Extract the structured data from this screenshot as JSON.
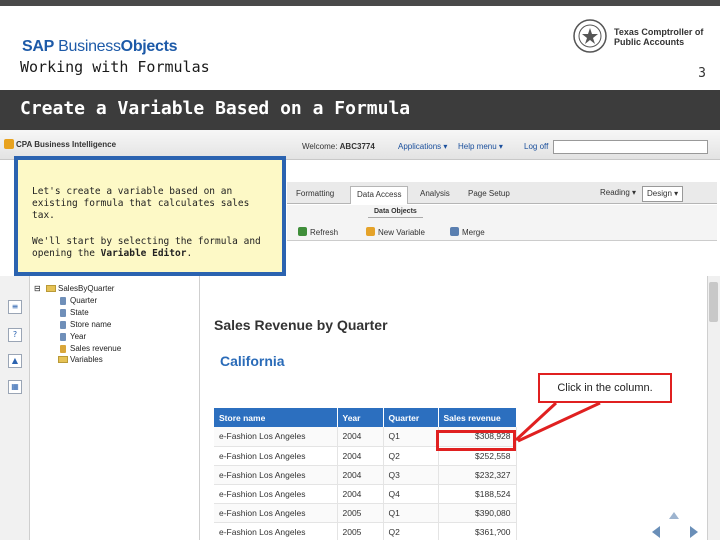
{
  "slide": {
    "logo_sap": "SAP",
    "logo_business": " Business",
    "logo_objects": "Objects",
    "subtitle": "Working with Formulas",
    "page_number": "3",
    "org_line1": "Texas Comptroller of",
    "org_line2": "Public Accounts",
    "section_title": "Create a Variable Based on a Formula"
  },
  "app": {
    "brand": "CPA Business Intelligence",
    "welcome_label": "Welcome:",
    "welcome_user": "ABC3774",
    "links": [
      "Applications ▾",
      "Help menu ▾",
      "Log off"
    ],
    "tabs": [
      "Formatting",
      "Data Access",
      "Analysis",
      "Page Setup"
    ],
    "active_tab": "Data Access",
    "modes": [
      "Reading ▾",
      "Design ▾"
    ],
    "data_objects_label": "Data Objects",
    "toolbar": {
      "refresh": "Refresh",
      "new_variable": "New Variable",
      "merge": "Merge"
    }
  },
  "tooltip": {
    "para1": "Let's create a variable based on an existing formula that calculates sales tax.",
    "para2_a": "We'll start by selecting the formula and opening the ",
    "para2_b": "Variable Editor",
    "para2_c": "."
  },
  "tree": {
    "root": "SalesByQuarter",
    "items": [
      "Quarter",
      "State",
      "Store name",
      "Year",
      "Sales revenue"
    ],
    "folder": "Variables"
  },
  "report": {
    "title": "Sales Revenue by Quarter",
    "subtitle": "California",
    "columns": [
      "Store name",
      "Year",
      "Quarter",
      "Sales revenue"
    ],
    "rows": [
      [
        "e-Fashion Los Angeles",
        "2004",
        "Q1",
        "$308,928"
      ],
      [
        "e-Fashion Los Angeles",
        "2004",
        "Q2",
        "$252,558"
      ],
      [
        "e-Fashion Los Angeles",
        "2004",
        "Q3",
        "$232,327"
      ],
      [
        "e-Fashion Los Angeles",
        "2004",
        "Q4",
        "$188,524"
      ],
      [
        "e-Fashion Los Angeles",
        "2005",
        "Q1",
        "$390,080"
      ],
      [
        "e-Fashion Los Angeles",
        "2005",
        "Q2",
        "$361,?00"
      ]
    ]
  },
  "callout": {
    "text": "Click in the column."
  },
  "colors": {
    "accent_blue": "#2c6fbf",
    "highlight_red": "#e02020",
    "tooltip_bg": "#fdf9c6"
  }
}
